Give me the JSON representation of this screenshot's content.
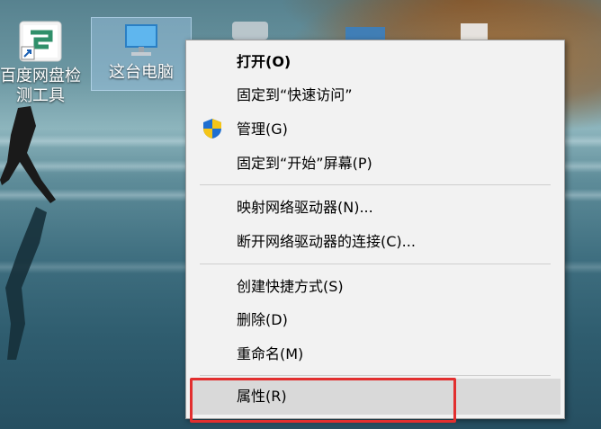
{
  "desktop": {
    "icons": [
      {
        "label_line1": "百度网盘检",
        "label_line2": "测工具",
        "icon": "app-shortcut-icon"
      },
      {
        "label_line1": "这台电脑",
        "icon": "computer-icon"
      }
    ]
  },
  "context_menu": {
    "items": [
      {
        "label": "打开(O)",
        "bold": true
      },
      {
        "label": "固定到“快速访问”"
      },
      {
        "label": "管理(G)",
        "icon": "uac-shield-icon"
      },
      {
        "label": "固定到“开始”屏幕(P)"
      },
      {
        "label": "映射网络驱动器(N)..."
      },
      {
        "label": "断开网络驱动器的连接(C)..."
      },
      {
        "label": "创建快捷方式(S)"
      },
      {
        "label": "删除(D)"
      },
      {
        "label": "重命名(M)"
      },
      {
        "label": "属性(R)",
        "hovered": true
      }
    ]
  },
  "annotation": {
    "color": "#e22f2f"
  }
}
